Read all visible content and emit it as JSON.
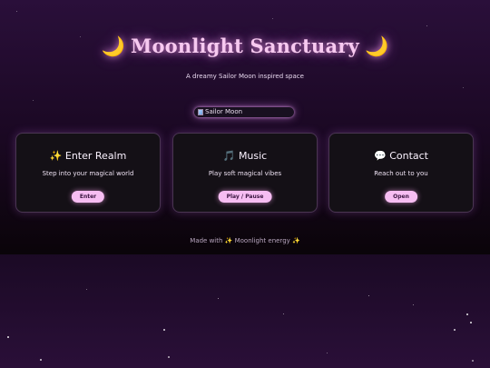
{
  "header": {
    "moon_left": "🌙",
    "title": "Moonlight Sanctuary",
    "moon_right": "🌙",
    "subtitle": "A dreamy Sailor Moon inspired space"
  },
  "banner": {
    "alt_text": "Sailor Moon"
  },
  "cards": [
    {
      "icon": "✨",
      "title": "Enter Realm",
      "description": "Step into your magical world",
      "button": "Enter"
    },
    {
      "icon": "🎵",
      "title": "Music",
      "description": "Play soft magical vibes",
      "button": "Play / Pause"
    },
    {
      "icon": "💬",
      "title": "Contact",
      "description": "Reach out to you",
      "button": "Open"
    }
  ],
  "footer": {
    "text": "Made with ✨ Moonlight energy ✨"
  },
  "colors": {
    "accent": "#f6bdf2",
    "title_glow": "#f7c9f0",
    "background": "#0e0614"
  }
}
